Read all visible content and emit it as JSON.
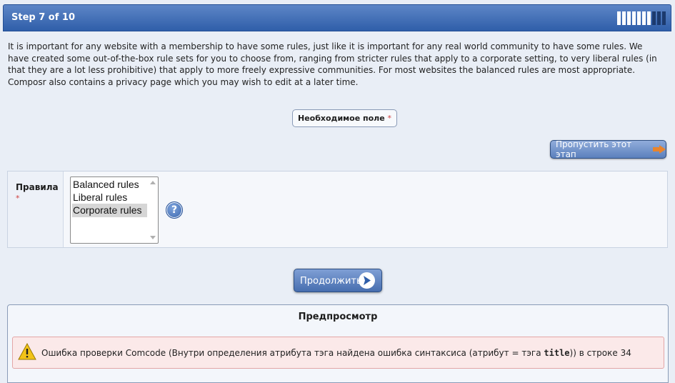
{
  "header": {
    "title": "Step 7 of 10",
    "progress": {
      "current": 7,
      "total": 10
    }
  },
  "intro": "It is important for any website with a membership to have some rules, just like it is important for any real world community to have some rules. We have created some out-of-the-box rule sets for you to choose from, ranging from stricter rules that apply to a corporate setting, to very liberal rules (in that they are a lot less prohibitive) that apply to more freely expressive communities. For most websites the balanced rules are most appropriate. Composr also contains a privacy page which you may wish to edit at a later time.",
  "required_note": {
    "label": "Необходимое поле",
    "star": "*"
  },
  "skip_button": {
    "label": "Пропустить этот этап",
    "icon": "arrow-right-icon",
    "color": "#e8842c"
  },
  "field": {
    "label": "Правила",
    "star": "*",
    "options": [
      "Balanced rules",
      "Liberal rules",
      "Corporate rules"
    ],
    "selected": "Corporate rules",
    "help_icon": "?"
  },
  "continue_button": {
    "label": "Продолжить",
    "icon": "arrow-right-circle-icon"
  },
  "preview": {
    "title": "Предпросмотр",
    "error": {
      "icon": "warning-icon",
      "text_before": "Ошибка проверки Comcode (Внутри определения атрибута тэга найдена ошибка синтаксиса (атрибут = тэга ",
      "code": "title",
      "text_after": ")) в строке 34"
    }
  },
  "colors": {
    "header": "#2f5ea9",
    "accent_button": "#5b80bd",
    "error_bg": "#fbe9e9",
    "required_star": "#d04040"
  }
}
